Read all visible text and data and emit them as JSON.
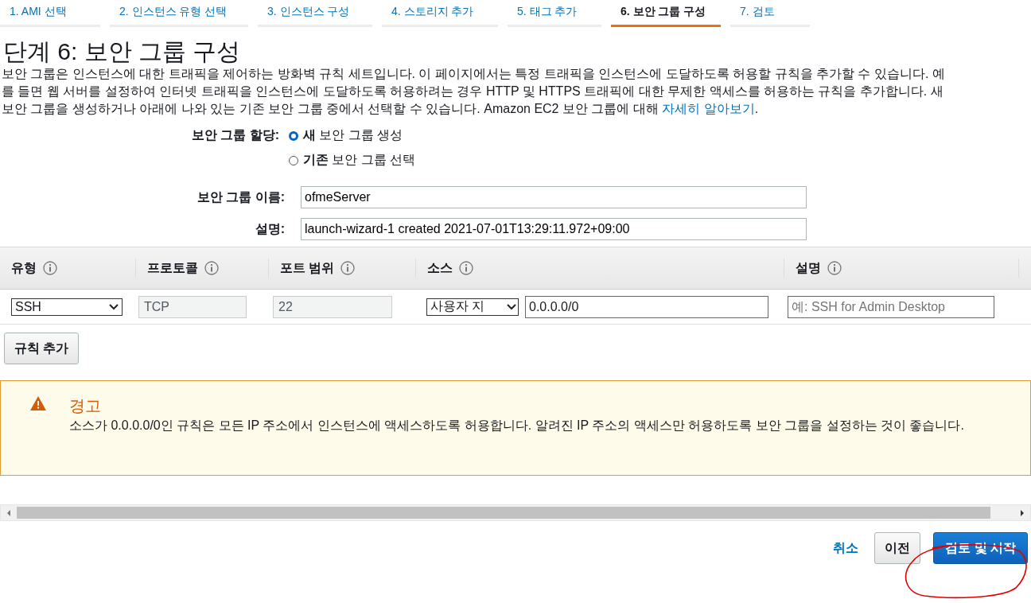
{
  "steps": [
    {
      "label": "1. AMI 선택",
      "selected": false
    },
    {
      "label": "2. 인스턴스 유형 선택",
      "selected": false
    },
    {
      "label": "3. 인스턴스 구성",
      "selected": false
    },
    {
      "label": "4. 스토리지 추가",
      "selected": false
    },
    {
      "label": "5. 태그 추가",
      "selected": false
    },
    {
      "label": "6. 보안 그룹 구성",
      "selected": true
    },
    {
      "label": "7. 검토",
      "selected": false
    }
  ],
  "page_title": "단계 6: 보안 그룹 구성",
  "description_lines": [
    "보안 그룹은 인스턴스에 대한 트래픽을 제어하는 방화벽 규칙 세트입니다. 이 페이지에서는 특정 트래픽을 인스턴스에 도달하도록 허용할 규칙을 추가할 수 있습니다. 예",
    "를 들면 웹 서버를 설정하여 인터넷 트래픽을 인스턴스에 도달하도록 허용하려는 경우 HTTP 및 HTTPS 트래픽에 대한 무제한 액세스를 허용하는 규칙을 추가합니다. 새",
    "보안 그룹을 생성하거나 아래에 나와 있는 기존 보안 그룹 중에서 선택할 수 있습니다. Amazon EC2 보안 그룹에 대해"
  ],
  "description_link": "자세히 알아보기",
  "description_end": ".",
  "assign": {
    "label": "보안 그룹 할당:",
    "options": [
      {
        "bold": "새",
        "rest": "보안 그룹 생성",
        "selected": true
      },
      {
        "bold": "기존",
        "rest": "보안 그룹 선택",
        "selected": false
      }
    ]
  },
  "fields": [
    {
      "label": "보안 그룹 이름:",
      "value": "ofmeServer"
    },
    {
      "label": "설명:",
      "value": "launch-wizard-1 created 2021-07-01T13:29:11.972+09:00"
    }
  ],
  "table": {
    "columns": [
      "유형",
      "프로토콜",
      "포트 범위",
      "소스",
      "설명"
    ],
    "rows": [
      {
        "type": "SSH",
        "protocol": "TCP",
        "port": "22",
        "source_type": "사용자 지",
        "source": "0.0.0.0/0",
        "description_placeholder": "예: SSH for Admin Desktop"
      }
    ]
  },
  "add_rule_button": "규칙 추가",
  "warning": {
    "title": "경고",
    "text": "소스가 0.0.0.0/0인 규칙은 모든 IP 주소에서 인스턴스에 액세스하도록 허용합니다. 알려진 IP 주소의 액세스만 허용하도록 보안 그룹을 설정하는 것이 좋습니다."
  },
  "buttons": [
    {
      "label": "취소",
      "kind": "link"
    },
    {
      "label": "이전",
      "kind": "secondary"
    },
    {
      "label": "검토 및 시작",
      "kind": "primary"
    }
  ]
}
